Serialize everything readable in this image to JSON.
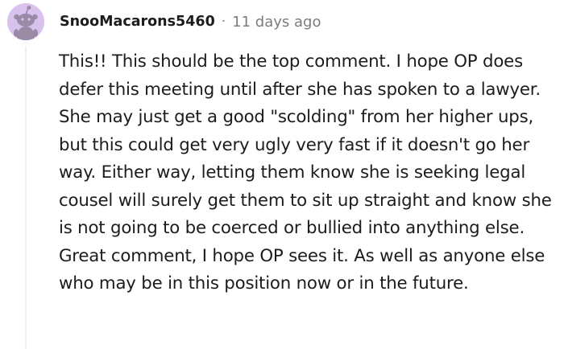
{
  "comment": {
    "username": "SnooMacarons5460",
    "separator": "·",
    "timestamp": "11 days ago",
    "body": "This!! This should be the top comment. I hope OP does defer this meeting until after she has spoken to a lawyer. She may just get a good \"scolding\" from her higher ups, but this could get very ugly very fast if it doesn't go her way. Either way, letting them know she is seeking legal cousel will surely get them to sit up straight and know she is not going to be coerced or bullied into anything else. Great comment, I hope OP sees it. As well as anyone else who may be in this position now or in the future."
  },
  "avatar": {
    "icon": "snoo-avatar-icon",
    "background_color": "#d9c2ee",
    "figure_color": "#9a8aa6"
  },
  "colors": {
    "text": "#1c1c1c",
    "meta": "#7c7c7c",
    "thread_line": "#edeff1"
  }
}
